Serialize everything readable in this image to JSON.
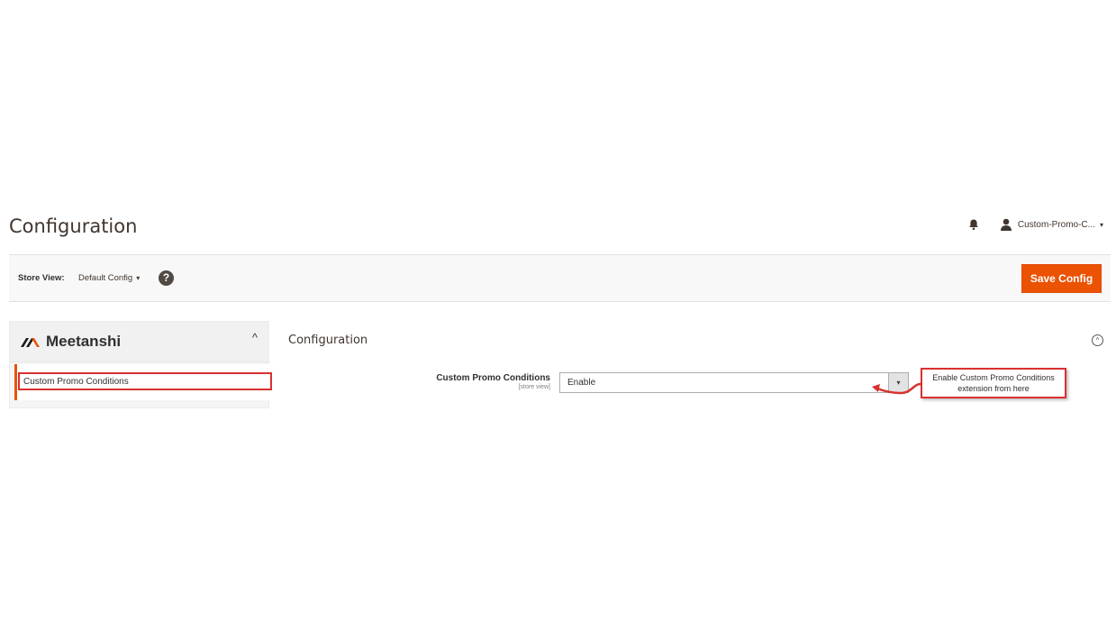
{
  "header": {
    "page_title": "Configuration",
    "user_name": "Custom-Promo-C...",
    "user_caret": "▾"
  },
  "store_bar": {
    "label": "Store View:",
    "selected_scope": "Default Config",
    "caret": "▾",
    "help_glyph": "?",
    "save_button_label": "Save Config"
  },
  "sidebar": {
    "brand_name": "Meetanshi",
    "chevron": "^",
    "items": [
      {
        "label": "Custom Promo Conditions"
      }
    ]
  },
  "section": {
    "title": "Configuration",
    "toggle_glyph": "^",
    "field": {
      "label": "Custom Promo Conditions",
      "scope": "[store view]",
      "value": "Enable",
      "arrow": "▾"
    }
  },
  "annotation": {
    "line1": "Enable Custom Promo Conditions",
    "line2": "extension from here"
  },
  "colors": {
    "accent": "#eb5202",
    "highlight_border": "#d9312f",
    "store_bar_bg": "#f8f8f8"
  },
  "icons": [
    "bell-icon",
    "user-icon",
    "help-icon",
    "meetanshi-logo-icon",
    "chevron-up-icon",
    "collapse-circle-icon",
    "dropdown-arrow-icon",
    "curved-arrow-icon"
  ]
}
